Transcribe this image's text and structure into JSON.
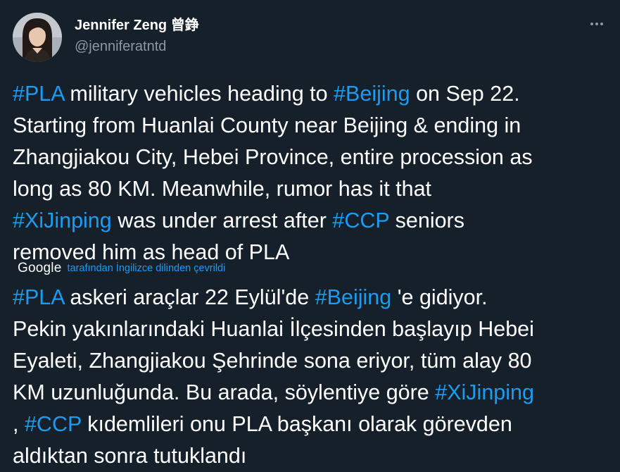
{
  "tweet": {
    "author": {
      "display_name": "Jennifer Zeng 曾錚",
      "handle": "@jenniferatntd"
    },
    "original_text": {
      "lines": [
        [
          {
            "t": "#PLA",
            "tag": true
          },
          {
            "t": " military vehicles heading to "
          },
          {
            "t": "#Beijing",
            "tag": true
          },
          {
            "t": " on Sep 22."
          }
        ],
        [
          {
            "t": "Starting from Huanlai County near Beijing & ending in"
          }
        ],
        [
          {
            "t": "Zhangjiakou City, Hebei Province, entire procession as"
          }
        ],
        [
          {
            "t": "long as 80 KM. Meanwhile, rumor has it that"
          }
        ],
        [
          {
            "t": "#XiJinping",
            "tag": true
          },
          {
            "t": " was under arrest after "
          },
          {
            "t": "#CCP",
            "tag": true
          },
          {
            "t": " seniors"
          }
        ],
        [
          {
            "t": "removed him as head of PLA"
          }
        ]
      ]
    },
    "translation": {
      "provider": "Google",
      "note": "tarafından İngilizce dilinden çevrildi"
    },
    "translated_text": {
      "lines": [
        [
          {
            "t": "#PLA",
            "tag": true
          },
          {
            "t": " askeri araçlar 22 Eylül'de "
          },
          {
            "t": "#Beijing",
            "tag": true
          },
          {
            "t": " 'e gidiyor."
          }
        ],
        [
          {
            "t": "Pekin yakınlarındaki Huanlai İlçesinden başlayıp Hebei"
          }
        ],
        [
          {
            "t": "Eyaleti, Zhangjiakou Şehrinde sona eriyor, tüm alay 80"
          }
        ],
        [
          {
            "t": "KM uzunluğunda. Bu arada, söylentiye göre "
          },
          {
            "t": "#XiJinping",
            "tag": true
          }
        ],
        [
          {
            "t": ", "
          },
          {
            "t": "#CCP",
            "tag": true
          },
          {
            "t": " kıdemlileri onu PLA başkanı olarak görevden"
          }
        ],
        [
          {
            "t": "aldıktan sonra tutuklandı"
          }
        ]
      ]
    },
    "more_icon": "more-horizontal-icon",
    "colors": {
      "background": "#15202b",
      "text": "#ffffff",
      "secondary": "#8b98a5",
      "accent": "#1d9bf0"
    }
  }
}
